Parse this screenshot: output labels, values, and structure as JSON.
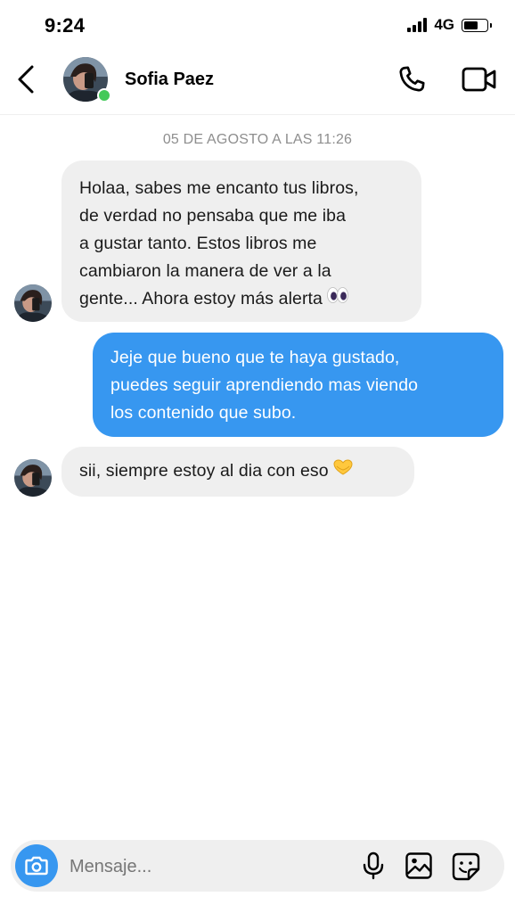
{
  "status_bar": {
    "time": "9:24",
    "network": "4G"
  },
  "header": {
    "contact_name": "Sofia Paez",
    "online": true
  },
  "conversation": {
    "timestamp": "05 DE AGOSTO A LAS 11:26",
    "messages": [
      {
        "direction": "incoming",
        "lines": [
          "Holaa, sabes me encanto tus libros,",
          "de verdad no pensaba que me iba",
          "a gustar tanto. Estos libros me",
          "cambiaron la manera de ver a la",
          "gente... Ahora estoy más alerta"
        ],
        "emoji": "eyes-emoji"
      },
      {
        "direction": "outgoing",
        "lines": [
          "Jeje que bueno que te haya gustado,",
          "puedes seguir aprendiendo mas viendo",
          "los contenido que subo."
        ]
      },
      {
        "direction": "incoming",
        "lines": [
          "sii, siempre estoy al dia con eso"
        ],
        "emoji": "heart-hands-emoji"
      }
    ]
  },
  "composer": {
    "placeholder": "Mensaje..."
  },
  "colors": {
    "accent": "#3797f0",
    "incoming_bubble": "#efefef",
    "online": "#44c959"
  },
  "icons": [
    "back-chevron-icon",
    "phone-icon",
    "video-icon",
    "camera-icon",
    "microphone-icon",
    "gallery-icon",
    "sticker-icon"
  ]
}
